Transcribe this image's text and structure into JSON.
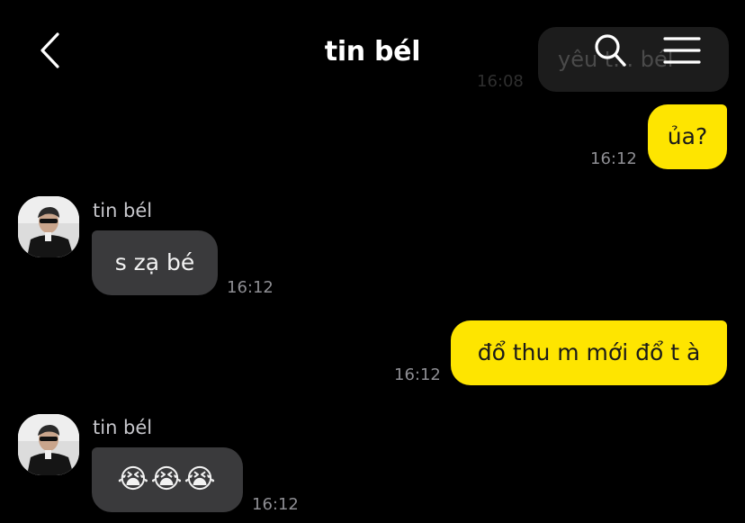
{
  "header": {
    "title": "tin bél",
    "back_icon": "chevron-left-icon",
    "search_icon": "search-icon",
    "menu_icon": "hamburger-menu-icon"
  },
  "colors": {
    "background": "#000000",
    "mine_bubble": "#fee500",
    "theirs_bubble": "#3a3a3c",
    "timestamp": "#8e8e93"
  },
  "messages": [
    {
      "sender": "me",
      "text": "yêu t... bél",
      "time": "16:08",
      "partially_hidden": true
    },
    {
      "sender": "me",
      "text": "ủa?",
      "time": "16:12"
    },
    {
      "sender": "them",
      "name": "tin bél",
      "text": "s zạ bé",
      "time": "16:12"
    },
    {
      "sender": "me",
      "text": "đổ thu m mới đổ t à",
      "time": "16:12"
    },
    {
      "sender": "them",
      "name": "tin bél",
      "text": "😭😭😭",
      "time": "16:12"
    }
  ]
}
